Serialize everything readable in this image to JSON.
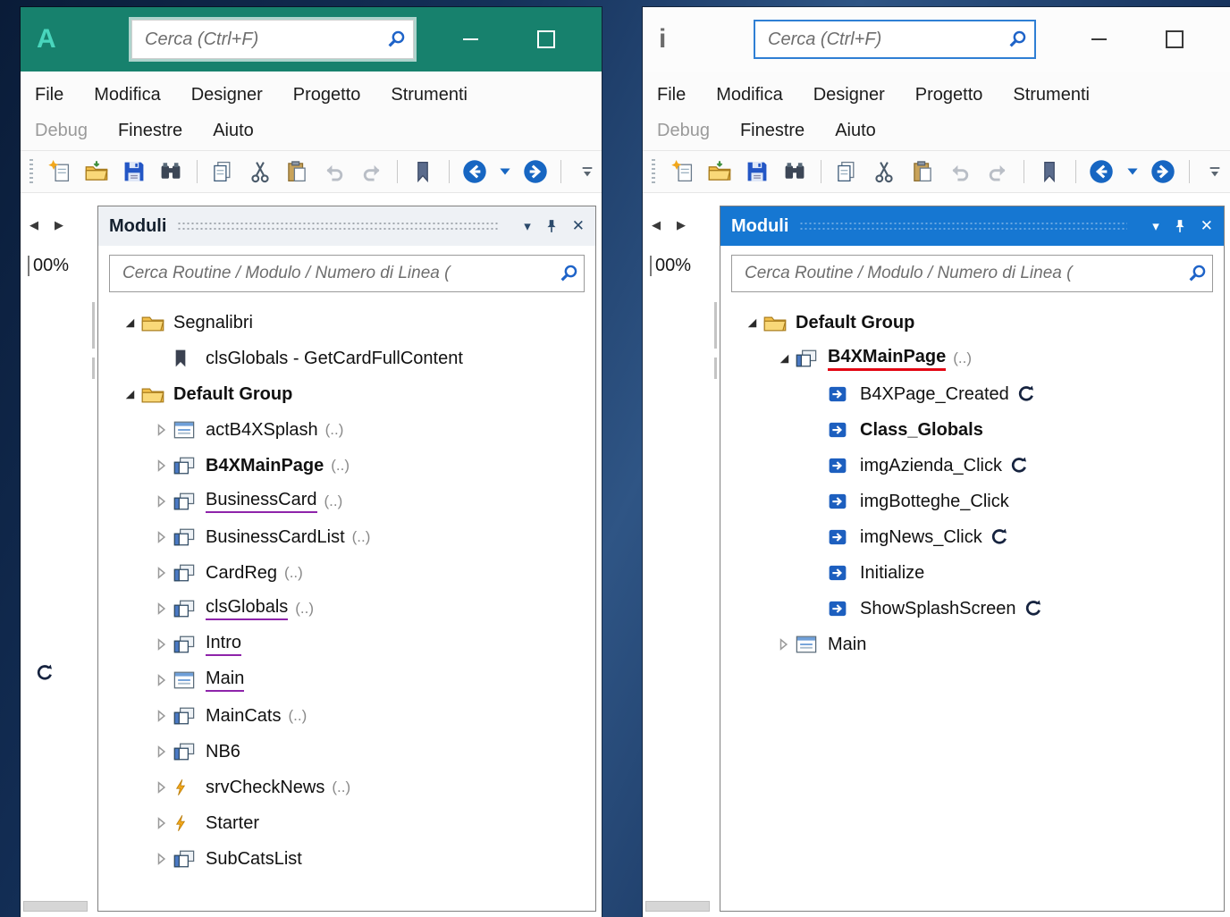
{
  "shared": {
    "search_placeholder": "Cerca (Ctrl+F)",
    "panel_title": "Moduli",
    "panel_search_placeholder": "Cerca Routine / Modulo / Numero di Linea (",
    "zoom_label": "00%",
    "menu": {
      "row1": [
        "File",
        "Modifica",
        "Designer",
        "Progetto",
        "Strumenti"
      ],
      "row2": [
        {
          "label": "Debug",
          "disabled": true
        },
        {
          "label": "Finestre",
          "disabled": false
        },
        {
          "label": "Aiuto",
          "disabled": false
        }
      ]
    },
    "toolbar": [
      "grip",
      "new-file",
      "open-project",
      "save",
      "find-in-files",
      "sep",
      "copy",
      "cut",
      "paste",
      "undo",
      "redo",
      "sep",
      "bookmark",
      "sep",
      "navigate-back",
      "history-dropdown",
      "navigate-forward",
      "sep",
      "toolbar-overflow"
    ],
    "colors": {
      "b4a_titlebar": "#17816d",
      "b4a_logo": "#49d6bd",
      "b4i_panel_header": "#1677d2",
      "purple_underline": "#8e24aa",
      "red_underline": "#e30613",
      "nav_blue": "#1766c2"
    }
  },
  "left_window": {
    "logo": "A",
    "tree": [
      {
        "label": "Segnalibri",
        "icon": "folder",
        "level": 0,
        "arrow": "expanded"
      },
      {
        "label": "clsGlobals - GetCardFullContent",
        "icon": "bookmark",
        "level": 1
      },
      {
        "label": "Default Group",
        "icon": "folder",
        "level": 0,
        "arrow": "expanded",
        "bold": true
      },
      {
        "label": "actB4XSplash",
        "suffix": "(..)",
        "icon": "activity",
        "level": 1,
        "arrow": "collapsed"
      },
      {
        "label": "B4XMainPage",
        "suffix": "(..)",
        "icon": "class",
        "level": 1,
        "arrow": "collapsed",
        "bold": true
      },
      {
        "label": "BusinessCard",
        "suffix": "(..)",
        "icon": "class",
        "level": 1,
        "arrow": "collapsed",
        "underline": "purple"
      },
      {
        "label": "BusinessCardList",
        "suffix": "(..)",
        "icon": "class",
        "level": 1,
        "arrow": "collapsed"
      },
      {
        "label": "CardReg",
        "suffix": "(..)",
        "icon": "class",
        "level": 1,
        "arrow": "collapsed"
      },
      {
        "label": "clsGlobals",
        "suffix": "(..)",
        "icon": "class",
        "level": 1,
        "arrow": "collapsed",
        "underline": "purple"
      },
      {
        "label": "Intro",
        "icon": "class",
        "level": 1,
        "arrow": "collapsed",
        "underline": "purple"
      },
      {
        "label": "Main",
        "icon": "activity",
        "level": 1,
        "arrow": "collapsed",
        "underline": "purple"
      },
      {
        "label": "MainCats",
        "suffix": "(..)",
        "icon": "class",
        "level": 1,
        "arrow": "collapsed"
      },
      {
        "label": "NB6",
        "icon": "class",
        "level": 1,
        "arrow": "collapsed"
      },
      {
        "label": "srvCheckNews",
        "suffix": "(..)",
        "icon": "service",
        "level": 1,
        "arrow": "collapsed"
      },
      {
        "label": "Starter",
        "icon": "service",
        "level": 1,
        "arrow": "collapsed"
      },
      {
        "label": "SubCatsList",
        "icon": "class",
        "level": 1,
        "arrow": "collapsed"
      }
    ]
  },
  "right_window": {
    "logo": "i",
    "tree": [
      {
        "label": "Default Group",
        "icon": "folder",
        "level": 0,
        "arrow": "expanded",
        "bold": true
      },
      {
        "label": "B4XMainPage",
        "suffix": "(..)",
        "icon": "class",
        "level": 1,
        "arrow": "expanded",
        "bold": true,
        "underline": "red"
      },
      {
        "label": "B4XPage_Created",
        "icon": "sub",
        "level": 2,
        "resumable": true
      },
      {
        "label": "Class_Globals",
        "icon": "sub",
        "level": 2,
        "bold": true
      },
      {
        "label": "imgAzienda_Click",
        "icon": "sub",
        "level": 2,
        "resumable": true
      },
      {
        "label": "imgBotteghe_Click",
        "icon": "sub",
        "level": 2
      },
      {
        "label": "imgNews_Click",
        "icon": "sub",
        "level": 2,
        "resumable": true
      },
      {
        "label": "Initialize",
        "icon": "sub",
        "level": 2
      },
      {
        "label": "ShowSplashScreen",
        "icon": "sub",
        "level": 2,
        "resumable": true
      },
      {
        "label": "Main",
        "icon": "activity",
        "level": 1,
        "arrow": "collapsed"
      }
    ]
  }
}
